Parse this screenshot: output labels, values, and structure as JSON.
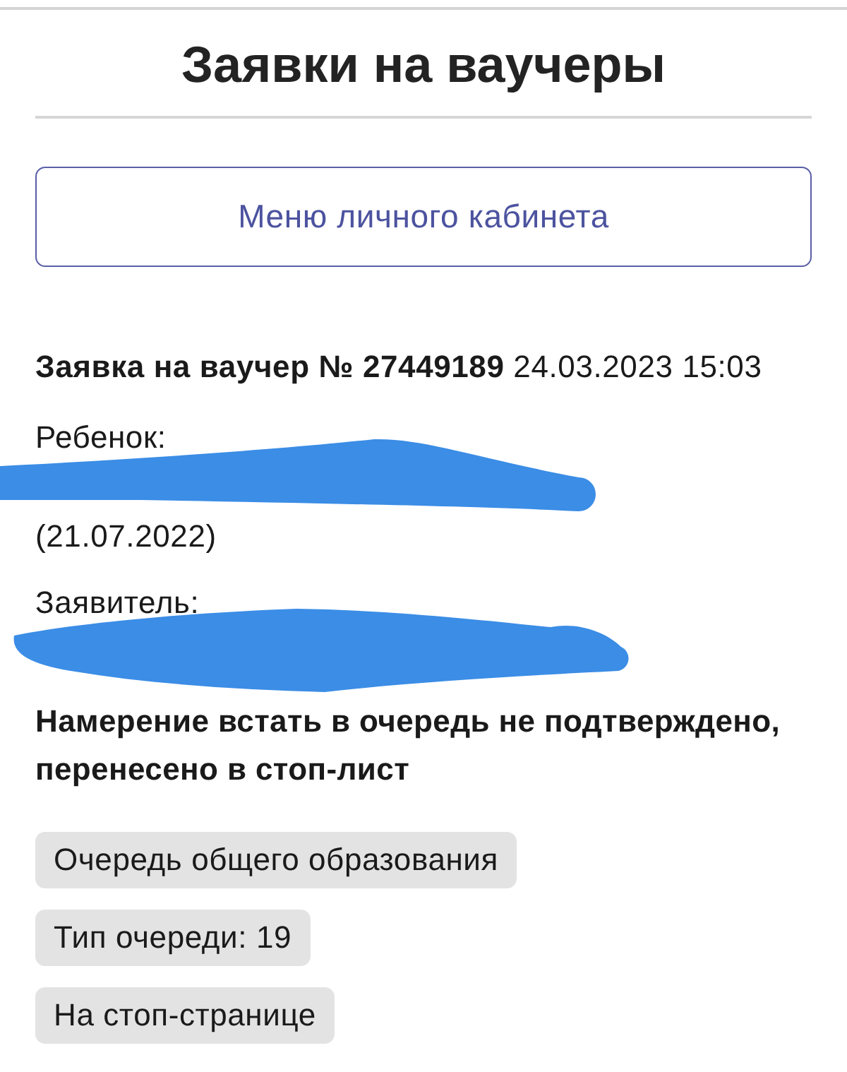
{
  "header": {
    "title": "Заявки на ваучеры"
  },
  "menu_button": {
    "label": "Меню личного кабинета"
  },
  "application": {
    "heading": "**Заявка на ваучер № 27449189** 24.03.2023 15:03",
    "child_label": "Ребенок:",
    "child_birthdate": "(21.07.2022)",
    "applicant_label": "Заявитель:",
    "status": "Намерение встать в очередь не подтверждено, перенесено в стоп-лист",
    "tags": [
      "Очередь общего образования",
      "Тип очереди: 19",
      "На стоп-странице"
    ]
  }
}
